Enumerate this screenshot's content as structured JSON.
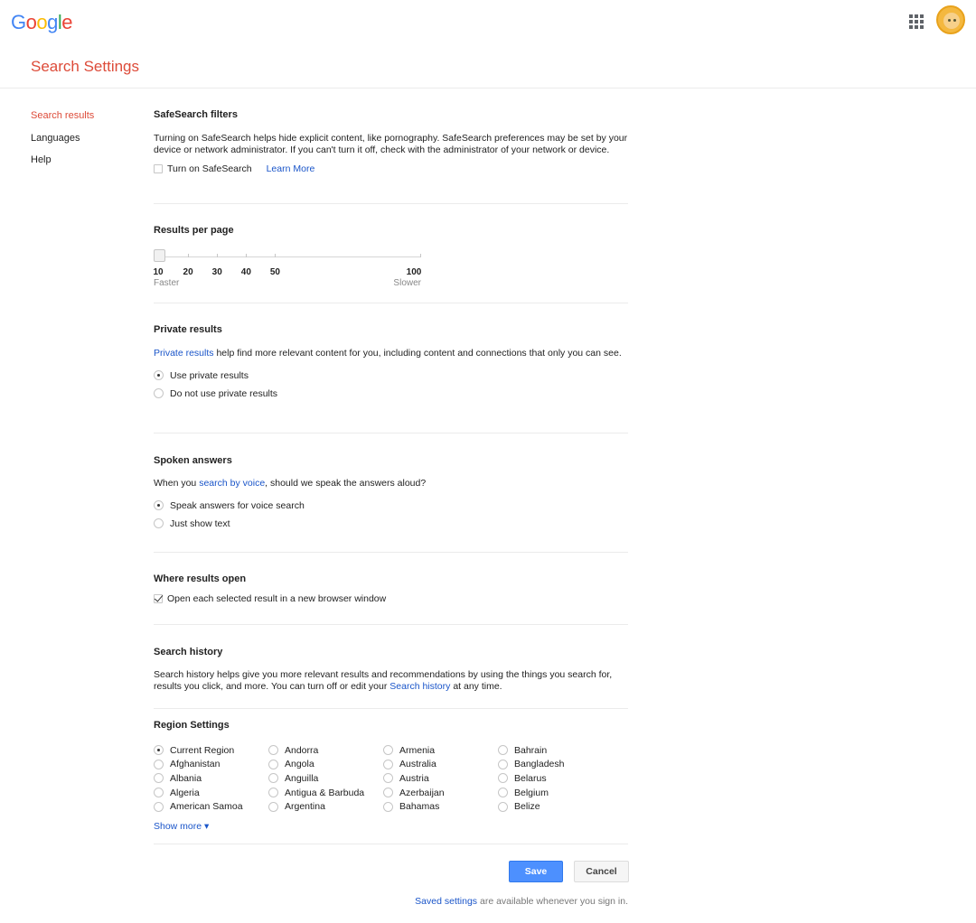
{
  "header": {
    "logo_letters": [
      {
        "ch": "G",
        "color": "#4285f4"
      },
      {
        "ch": "o",
        "color": "#ea4335"
      },
      {
        "ch": "o",
        "color": "#fbbc05"
      },
      {
        "ch": "g",
        "color": "#4285f4"
      },
      {
        "ch": "l",
        "color": "#34a853"
      },
      {
        "ch": "e",
        "color": "#ea4335"
      }
    ],
    "apps_icon": "apps-grid-icon",
    "avatar_icon": "user-avatar",
    "page_title": "Search Settings"
  },
  "sidebar": {
    "items": [
      {
        "label": "Search results",
        "active": true
      },
      {
        "label": "Languages",
        "active": false
      },
      {
        "label": "Help",
        "active": false
      }
    ]
  },
  "safesearch": {
    "title": "SafeSearch filters",
    "description": "Turning on SafeSearch helps hide explicit content, like pornography. SafeSearch preferences may be set by your device or network administrator. If you can't turn it off, check with the administrator of your network or device.",
    "checkbox_label": "Turn on SafeSearch",
    "checked": false,
    "learn_more": "Learn More"
  },
  "results_per_page": {
    "title": "Results per page",
    "value": 10,
    "ticks": [
      10,
      20,
      30,
      40,
      50,
      100
    ],
    "tick_labels": [
      "10",
      "20",
      "30",
      "40",
      "50",
      "100"
    ],
    "left_label": "Faster",
    "right_label": "Slower"
  },
  "private_results": {
    "title": "Private results",
    "link": "Private results",
    "description": " help find more relevant content for you, including content and connections that only you can see.",
    "options": [
      {
        "label": "Use private results",
        "selected": true
      },
      {
        "label": "Do not use private results",
        "selected": false
      }
    ]
  },
  "spoken_answers": {
    "title": "Spoken answers",
    "desc_before": "When you ",
    "link": "search by voice",
    "desc_after": ", should we speak the answers aloud?",
    "options": [
      {
        "label": "Speak answers for voice search",
        "selected": true
      },
      {
        "label": "Just show text",
        "selected": false
      }
    ]
  },
  "where_results_open": {
    "title": "Where results open",
    "checkbox_label": "Open each selected result in a new browser window",
    "checked": true
  },
  "search_history": {
    "title": "Search history",
    "desc_before": "Search history helps give you more relevant results and recommendations by using the things you search for, results you click, and more. You can turn off or edit your ",
    "link": "Search history",
    "desc_after": " at any time."
  },
  "region_settings": {
    "title": "Region Settings",
    "columns": [
      [
        "Current Region",
        "Afghanistan",
        "Albania",
        "Algeria",
        "American Samoa"
      ],
      [
        "Andorra",
        "Angola",
        "Anguilla",
        "Antigua & Barbuda",
        "Argentina"
      ],
      [
        "Armenia",
        "Australia",
        "Austria",
        "Azerbaijan",
        "Bahamas"
      ],
      [
        "Bahrain",
        "Bangladesh",
        "Belarus",
        "Belgium",
        "Belize"
      ]
    ],
    "selected": "Current Region",
    "show_more": "Show more ▾"
  },
  "actions": {
    "save_label": "Save",
    "cancel_label": "Cancel"
  },
  "footer": {
    "link": "Saved settings",
    "text": " are available whenever you sign in."
  }
}
